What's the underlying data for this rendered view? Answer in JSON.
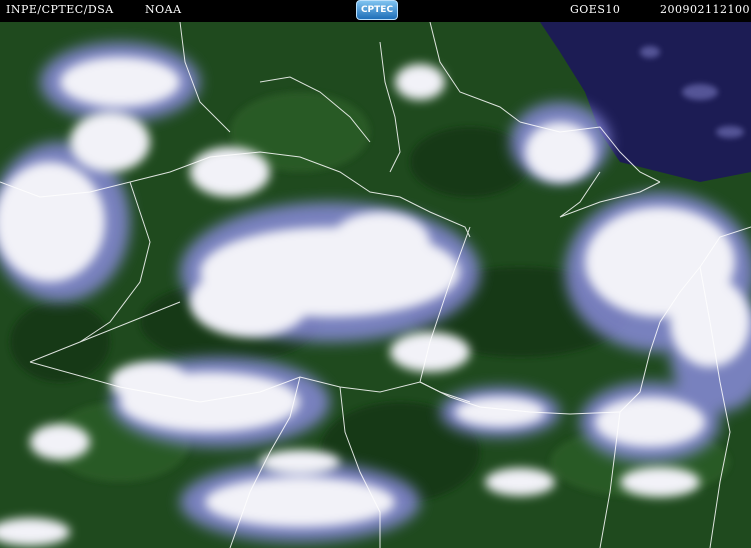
{
  "header": {
    "source": "INPE/CPTEC/DSA",
    "agency": "NOAA",
    "logo": "CPTEC",
    "satellite": "GOES10",
    "timestamp": "200902112100"
  },
  "colors": {
    "forest": "#1f4a1e",
    "forest_dark": "#163716",
    "cloud": "#f2f2f8",
    "cloud_edge": "#8f8fe6",
    "ocean": "#1c1c54",
    "border": "#ffffff",
    "background": "#000000"
  },
  "icons": {
    "logo": "cptec-logo-icon"
  }
}
